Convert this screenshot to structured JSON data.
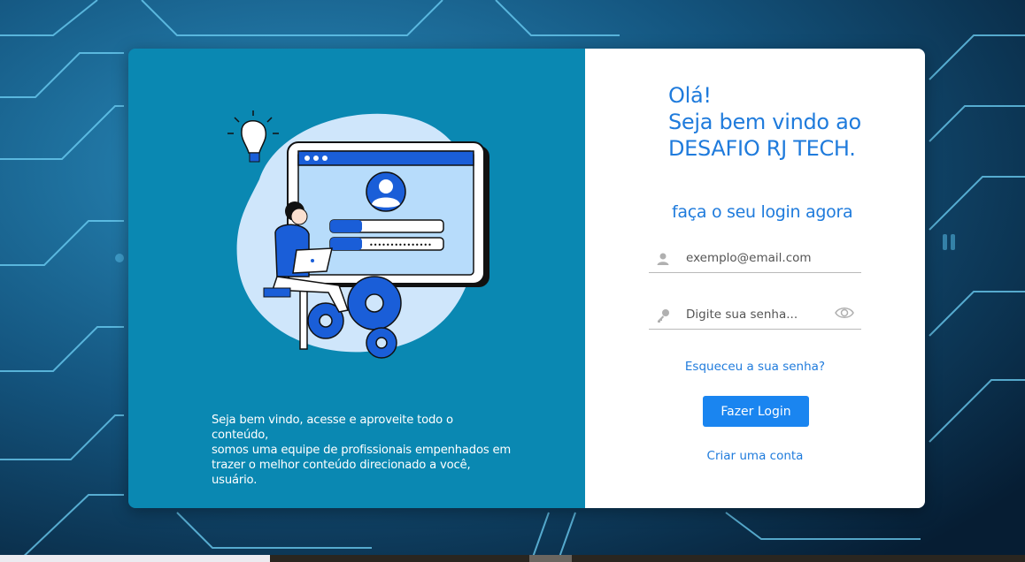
{
  "colors": {
    "left_panel": "#0a88b2",
    "accent": "#1f7bdc",
    "button": "#1a85f0",
    "background": "#0b2f4f"
  },
  "left": {
    "intro_lines": [
      "Seja bem vindo, acesse e aproveite todo o conteúdo,",
      "somos uma equipe de profissionais empenhados em",
      "trazer o melhor conteúdo direcionado a você, usuário."
    ],
    "illustration": "login-illustration",
    "password_mask": "•••••••••••••••"
  },
  "right": {
    "greeting_lines": [
      "Olá!",
      "Seja bem vindo ao",
      "DESAFIO RJ TECH."
    ],
    "subtitle": "faça o seu login agora",
    "email": {
      "icon": "user-icon",
      "placeholder": "exemplo@email.com",
      "value": ""
    },
    "password": {
      "icon": "key-icon",
      "placeholder": "Digite sua senha...",
      "value": "",
      "toggle_icon": "eye-icon"
    },
    "forgot_label": "Esqueceu a sua senha?",
    "login_label": "Fazer Login",
    "signup_label": "Criar uma conta"
  }
}
